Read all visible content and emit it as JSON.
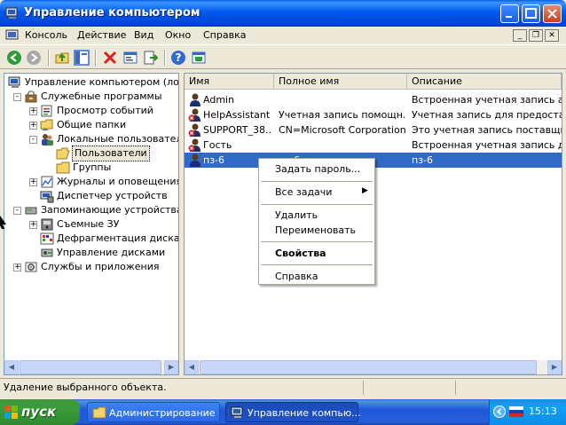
{
  "window": {
    "title": "Управление компьютером"
  },
  "menubar": {
    "items": [
      "Консоль",
      "Действие",
      "Вид",
      "Окно",
      "Справка"
    ]
  },
  "tree": {
    "items": [
      {
        "label": "Управление компьютером (локаль",
        "icon": "computer-icon",
        "level": 0,
        "expander": ""
      },
      {
        "label": "Служебные программы",
        "icon": "tools-icon",
        "level": 1,
        "expander": "−"
      },
      {
        "label": "Просмотр событий",
        "icon": "event-viewer-icon",
        "level": 2,
        "expander": "+"
      },
      {
        "label": "Общие папки",
        "icon": "shared-folders-icon",
        "level": 2,
        "expander": "+"
      },
      {
        "label": "Локальные пользователи",
        "icon": "users-icon",
        "level": 2,
        "expander": "−"
      },
      {
        "label": "Пользователи",
        "icon": "folder-open-icon",
        "level": 3,
        "expander": "",
        "selected": true
      },
      {
        "label": "Группы",
        "icon": "folder-icon",
        "level": 3,
        "expander": ""
      },
      {
        "label": "Журналы и оповещения пр",
        "icon": "performance-logs-icon",
        "level": 2,
        "expander": "+"
      },
      {
        "label": "Диспетчер устройств",
        "icon": "device-manager-icon",
        "level": 2,
        "expander": ""
      },
      {
        "label": "Запоминающие устройства",
        "icon": "storage-icon",
        "level": 1,
        "expander": "−"
      },
      {
        "label": "Съемные ЗУ",
        "icon": "removable-storage-icon",
        "level": 2,
        "expander": "+"
      },
      {
        "label": "Дефрагментация диска",
        "icon": "defrag-icon",
        "level": 2,
        "expander": ""
      },
      {
        "label": "Управление дисками",
        "icon": "disk-management-icon",
        "level": 2,
        "expander": ""
      },
      {
        "label": "Службы и приложения",
        "icon": "services-icon",
        "level": 1,
        "expander": "+"
      }
    ]
  },
  "list": {
    "columns": [
      "Имя",
      "Полное имя",
      "Описание"
    ],
    "rows": [
      {
        "name": "Admin",
        "full": "",
        "desc": "Встроенная учетная запись адм"
      },
      {
        "name": "HelpAssistant",
        "full": "Учетная запись помощн...",
        "desc": "Учетная запись для предоставле"
      },
      {
        "name": "SUPPORT_38...",
        "full": "CN=Microsoft Corporation...",
        "desc": "Это учетная запись поставщика"
      },
      {
        "name": "Гость",
        "full": "",
        "desc": "Встроенная учетная запись для ."
      },
      {
        "name": "пз-6",
        "full": "пз-6",
        "desc": "пз-6",
        "selected": true
      }
    ]
  },
  "context_menu": {
    "items": [
      {
        "label": "Задать пароль...",
        "bold": false,
        "submenu": false
      },
      {
        "label": "Все задачи",
        "bold": false,
        "submenu": true
      },
      {
        "label": "Удалить",
        "bold": false,
        "submenu": false
      },
      {
        "label": "Переименовать",
        "bold": false,
        "submenu": false
      },
      {
        "label": "Свойства",
        "bold": true,
        "submenu": false
      },
      {
        "label": "Справка",
        "bold": false,
        "submenu": false
      }
    ]
  },
  "status": {
    "text": "Удаление выбранного объекта."
  },
  "taskbar": {
    "start_label": "пуск",
    "tasks": [
      {
        "label": "Администрирование",
        "active": false
      },
      {
        "label": "Управление компью...",
        "active": true
      }
    ],
    "clock": "15:13"
  },
  "colors": {
    "selection": "#316ac5",
    "titlebar": "#0058ee",
    "start": "#3a9b3a"
  }
}
